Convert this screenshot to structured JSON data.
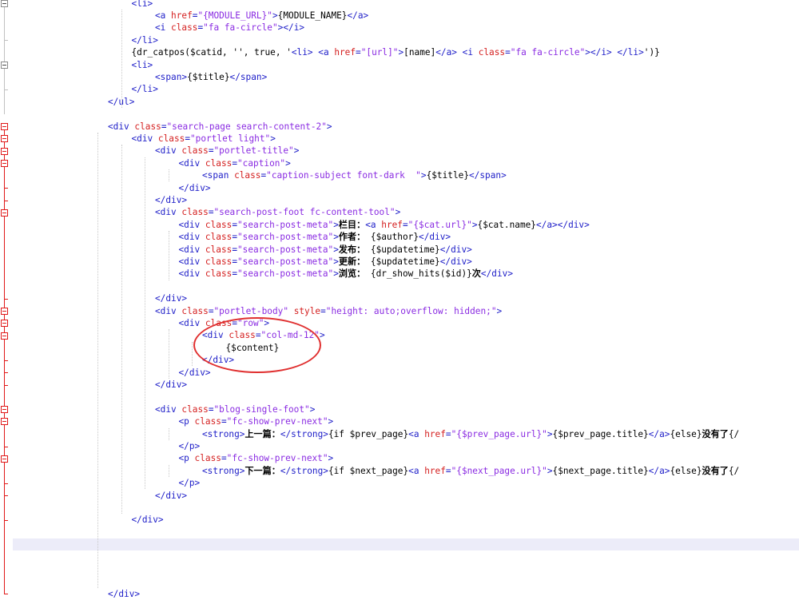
{
  "editor": {
    "lines": [
      {
        "indent": 5,
        "tokens": [
          [
            "tag",
            "<li>"
          ]
        ]
      },
      {
        "indent": 6,
        "tokens": [
          [
            "tag",
            "<a "
          ],
          [
            "attr",
            "href"
          ],
          [
            "tag",
            "="
          ],
          [
            "str",
            "\"{MODULE_URL}\""
          ],
          [
            "tag",
            ">"
          ],
          [
            "txt",
            "{MODULE_NAME}"
          ],
          [
            "tag",
            "</a>"
          ]
        ]
      },
      {
        "indent": 6,
        "tokens": [
          [
            "tag",
            "<i "
          ],
          [
            "attr",
            "class"
          ],
          [
            "tag",
            "="
          ],
          [
            "str",
            "\"fa fa-circle\""
          ],
          [
            "tag",
            "></i>"
          ]
        ]
      },
      {
        "indent": 5,
        "tokens": [
          [
            "tag",
            "</li>"
          ]
        ]
      },
      {
        "indent": 5,
        "tokens": [
          [
            "txt",
            "{dr_catpos($catid, '', true, '"
          ],
          [
            "tag",
            "<li> <a "
          ],
          [
            "attr",
            "href"
          ],
          [
            "tag",
            "="
          ],
          [
            "str",
            "\"[url]\""
          ],
          [
            "tag",
            ">"
          ],
          [
            "txt",
            "[name]"
          ],
          [
            "tag",
            "</a> <i "
          ],
          [
            "attr",
            "class"
          ],
          [
            "tag",
            "="
          ],
          [
            "str",
            "\"fa fa-circle\""
          ],
          [
            "tag",
            "></i> </li>"
          ],
          [
            "txt",
            "')}"
          ]
        ]
      },
      {
        "indent": 5,
        "tokens": [
          [
            "tag",
            "<li>"
          ]
        ]
      },
      {
        "indent": 6,
        "tokens": [
          [
            "tag",
            "<span>"
          ],
          [
            "txt",
            "{$title}"
          ],
          [
            "tag",
            "</span>"
          ]
        ]
      },
      {
        "indent": 5,
        "tokens": [
          [
            "tag",
            "</li>"
          ]
        ]
      },
      {
        "indent": 4,
        "tokens": [
          [
            "tag",
            "</ul>"
          ]
        ]
      },
      {
        "indent": 0,
        "tokens": []
      },
      {
        "indent": 4,
        "tokens": [
          [
            "tag",
            "<div "
          ],
          [
            "attr",
            "class"
          ],
          [
            "tag",
            "="
          ],
          [
            "str",
            "\"search-page search-content-2\""
          ],
          [
            "tag",
            ">"
          ]
        ]
      },
      {
        "indent": 5,
        "tokens": [
          [
            "tag",
            "<div "
          ],
          [
            "attr",
            "class"
          ],
          [
            "tag",
            "="
          ],
          [
            "str",
            "\"portlet light\""
          ],
          [
            "tag",
            ">"
          ]
        ]
      },
      {
        "indent": 6,
        "tokens": [
          [
            "tag",
            "<div "
          ],
          [
            "attr",
            "class"
          ],
          [
            "tag",
            "="
          ],
          [
            "str",
            "\"portlet-title\""
          ],
          [
            "tag",
            ">"
          ]
        ]
      },
      {
        "indent": 7,
        "tokens": [
          [
            "tag",
            "<div "
          ],
          [
            "attr",
            "class"
          ],
          [
            "tag",
            "="
          ],
          [
            "str",
            "\"caption\""
          ],
          [
            "tag",
            ">"
          ]
        ]
      },
      {
        "indent": 8,
        "tokens": [
          [
            "tag",
            "<span "
          ],
          [
            "attr",
            "class"
          ],
          [
            "tag",
            "="
          ],
          [
            "str",
            "\"caption-subject font-dark  \""
          ],
          [
            "tag",
            ">"
          ],
          [
            "txt",
            "{$title}"
          ],
          [
            "tag",
            "</span>"
          ]
        ]
      },
      {
        "indent": 7,
        "tokens": [
          [
            "tag",
            "</div>"
          ]
        ]
      },
      {
        "indent": 6,
        "tokens": [
          [
            "tag",
            "</div>"
          ]
        ]
      },
      {
        "indent": 6,
        "tokens": [
          [
            "tag",
            "<div "
          ],
          [
            "attr",
            "class"
          ],
          [
            "tag",
            "="
          ],
          [
            "str",
            "\"search-post-foot fc-content-tool\""
          ],
          [
            "tag",
            ">"
          ]
        ]
      },
      {
        "indent": 7,
        "tokens": [
          [
            "tag",
            "<div "
          ],
          [
            "attr",
            "class"
          ],
          [
            "tag",
            "="
          ],
          [
            "str",
            "\"search-post-meta\""
          ],
          [
            "tag",
            ">"
          ],
          [
            "cjk",
            "栏目："
          ],
          [
            "tag",
            "<a "
          ],
          [
            "attr",
            "href"
          ],
          [
            "tag",
            "="
          ],
          [
            "str",
            "\"{$cat.url}\""
          ],
          [
            "tag",
            ">"
          ],
          [
            "txt",
            "{$cat.name}"
          ],
          [
            "tag",
            "</a></div>"
          ]
        ]
      },
      {
        "indent": 7,
        "tokens": [
          [
            "tag",
            "<div "
          ],
          [
            "attr",
            "class"
          ],
          [
            "tag",
            "="
          ],
          [
            "str",
            "\"search-post-meta\""
          ],
          [
            "tag",
            ">"
          ],
          [
            "cjk",
            "作者："
          ],
          [
            "txt",
            " {$author}"
          ],
          [
            "tag",
            "</div>"
          ]
        ]
      },
      {
        "indent": 7,
        "tokens": [
          [
            "tag",
            "<div "
          ],
          [
            "attr",
            "class"
          ],
          [
            "tag",
            "="
          ],
          [
            "str",
            "\"search-post-meta\""
          ],
          [
            "tag",
            ">"
          ],
          [
            "cjk",
            "发布："
          ],
          [
            "txt",
            " {$updatetime}"
          ],
          [
            "tag",
            "</div>"
          ]
        ]
      },
      {
        "indent": 7,
        "tokens": [
          [
            "tag",
            "<div "
          ],
          [
            "attr",
            "class"
          ],
          [
            "tag",
            "="
          ],
          [
            "str",
            "\"search-post-meta\""
          ],
          [
            "tag",
            ">"
          ],
          [
            "cjk",
            "更新："
          ],
          [
            "txt",
            " {$updatetime}"
          ],
          [
            "tag",
            "</div>"
          ]
        ]
      },
      {
        "indent": 7,
        "tokens": [
          [
            "tag",
            "<div "
          ],
          [
            "attr",
            "class"
          ],
          [
            "tag",
            "="
          ],
          [
            "str",
            "\"search-post-meta\""
          ],
          [
            "tag",
            ">"
          ],
          [
            "cjk",
            "浏览："
          ],
          [
            "txt",
            " {dr_show_hits($id)}"
          ],
          [
            "cjk",
            "次"
          ],
          [
            "tag",
            "</div>"
          ]
        ]
      },
      {
        "indent": 0,
        "tokens": []
      },
      {
        "indent": 6,
        "tokens": [
          [
            "tag",
            "</div>"
          ]
        ]
      },
      {
        "indent": 6,
        "tokens": [
          [
            "tag",
            "<div "
          ],
          [
            "attr",
            "class"
          ],
          [
            "tag",
            "="
          ],
          [
            "str",
            "\"portlet-body\" "
          ],
          [
            "attr",
            "style"
          ],
          [
            "tag",
            "="
          ],
          [
            "str",
            "\"height: auto;overflow: hidden;\""
          ],
          [
            "tag",
            ">"
          ]
        ]
      },
      {
        "indent": 7,
        "tokens": [
          [
            "tag",
            "<div "
          ],
          [
            "attr",
            "class"
          ],
          [
            "tag",
            "="
          ],
          [
            "str",
            "\"row\""
          ],
          [
            "tag",
            ">"
          ]
        ]
      },
      {
        "indent": 8,
        "tokens": [
          [
            "tag",
            "<div "
          ],
          [
            "attr",
            "class"
          ],
          [
            "tag",
            "="
          ],
          [
            "str",
            "\"col-md-12\""
          ],
          [
            "tag",
            ">"
          ]
        ]
      },
      {
        "indent": 9,
        "tokens": [
          [
            "txt",
            "{$content}"
          ]
        ]
      },
      {
        "indent": 8,
        "tokens": [
          [
            "tag",
            "</div>"
          ]
        ]
      },
      {
        "indent": 7,
        "tokens": [
          [
            "tag",
            "</div>"
          ]
        ]
      },
      {
        "indent": 6,
        "tokens": [
          [
            "tag",
            "</div>"
          ]
        ]
      },
      {
        "indent": 0,
        "tokens": []
      },
      {
        "indent": 6,
        "tokens": [
          [
            "tag",
            "<div "
          ],
          [
            "attr",
            "class"
          ],
          [
            "tag",
            "="
          ],
          [
            "str",
            "\"blog-single-foot\""
          ],
          [
            "tag",
            ">"
          ]
        ]
      },
      {
        "indent": 7,
        "tokens": [
          [
            "tag",
            "<p "
          ],
          [
            "attr",
            "class"
          ],
          [
            "tag",
            "="
          ],
          [
            "str",
            "\"fc-show-prev-next\""
          ],
          [
            "tag",
            ">"
          ]
        ]
      },
      {
        "indent": 8,
        "tokens": [
          [
            "tag",
            "<strong>"
          ],
          [
            "cjk",
            "上一篇："
          ],
          [
            "tag",
            "</strong>"
          ],
          [
            "txt",
            "{if $prev_page}"
          ],
          [
            "tag",
            "<a "
          ],
          [
            "attr",
            "href"
          ],
          [
            "tag",
            "="
          ],
          [
            "str",
            "\"{$prev_page.url}\""
          ],
          [
            "tag",
            ">"
          ],
          [
            "txt",
            "{$prev_page.title}"
          ],
          [
            "tag",
            "</a>"
          ],
          [
            "txt",
            "{else}"
          ],
          [
            "cjk",
            "没有了"
          ],
          [
            "txt",
            "{/"
          ]
        ]
      },
      {
        "indent": 7,
        "tokens": [
          [
            "tag",
            "</p>"
          ]
        ]
      },
      {
        "indent": 7,
        "tokens": [
          [
            "tag",
            "<p "
          ],
          [
            "attr",
            "class"
          ],
          [
            "tag",
            "="
          ],
          [
            "str",
            "\"fc-show-prev-next\""
          ],
          [
            "tag",
            ">"
          ]
        ]
      },
      {
        "indent": 8,
        "tokens": [
          [
            "tag",
            "<strong>"
          ],
          [
            "cjk",
            "下一篇："
          ],
          [
            "tag",
            "</strong>"
          ],
          [
            "txt",
            "{if $next_page}"
          ],
          [
            "tag",
            "<a "
          ],
          [
            "attr",
            "href"
          ],
          [
            "tag",
            "="
          ],
          [
            "str",
            "\"{$next_page.url}\""
          ],
          [
            "tag",
            ">"
          ],
          [
            "txt",
            "{$next_page.title}"
          ],
          [
            "tag",
            "</a>"
          ],
          [
            "txt",
            "{else}"
          ],
          [
            "cjk",
            "没有了"
          ],
          [
            "txt",
            "{/"
          ]
        ]
      },
      {
        "indent": 7,
        "tokens": [
          [
            "tag",
            "</p>"
          ]
        ]
      },
      {
        "indent": 6,
        "tokens": [
          [
            "tag",
            "</div>"
          ]
        ]
      },
      {
        "indent": 0,
        "tokens": []
      },
      {
        "indent": 5,
        "tokens": [
          [
            "tag",
            "</div>"
          ]
        ]
      },
      {
        "indent": 0,
        "tokens": []
      },
      {
        "indent": 0,
        "tokens": [],
        "highlight": true
      },
      {
        "indent": 0,
        "tokens": []
      },
      {
        "indent": 0,
        "tokens": []
      },
      {
        "indent": 0,
        "tokens": []
      },
      {
        "indent": 4,
        "tokens": [
          [
            "tag",
            "</div>"
          ]
        ]
      }
    ],
    "colors": {
      "tag": "#1d1dc8",
      "attr": "#d41f1f",
      "string": "#8a2be2",
      "text": "#000000",
      "current_line": "#ececf9",
      "fold_marker_active": "#e01818",
      "annotation_circle": "#e03030"
    },
    "annotation": {
      "shape": "ellipse",
      "target": "col-md-12 content block"
    }
  }
}
